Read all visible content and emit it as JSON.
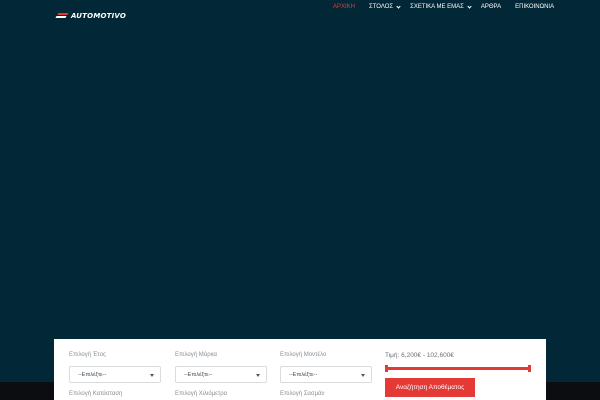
{
  "brand": {
    "logo_text": "AUTOMOTIVO"
  },
  "nav": {
    "items": [
      {
        "label": "ΑΡΧΙΚΗ",
        "active": true,
        "has_dropdown": false
      },
      {
        "label": "ΣΤΟΛΟΣ",
        "active": false,
        "has_dropdown": true
      },
      {
        "label": "ΣΧΕΤΙΚΑ ΜΕ ΕΜΑΣ",
        "active": false,
        "has_dropdown": true
      },
      {
        "label": "ΑΡΘΡΑ",
        "active": false,
        "has_dropdown": false
      },
      {
        "label": "ΕΠΙΚΟΙΝΩΝΙΑ",
        "active": false,
        "has_dropdown": false
      }
    ]
  },
  "search": {
    "fields": [
      {
        "label": "Επιλογή Έτος",
        "value": "--Επιλέξτε--"
      },
      {
        "label": "Επιλογή Μάρκα",
        "value": "--Επιλέξτε--"
      },
      {
        "label": "Επιλογή Μοντέλο",
        "value": "--Επιλέξτε--"
      }
    ],
    "second_row_labels": [
      "Επιλογή Κατάσταση",
      "Επιλογή Χιλιόμετρα",
      "Επιλογή Σασμάν"
    ],
    "price": {
      "label": "Τιμή:",
      "range_text": "6,200€ - 102,600€",
      "min_fraction": 0.0,
      "max_fraction": 1.0
    },
    "submit_label": "Αναζήτηση Αποθέματος"
  },
  "colors": {
    "background": "#022837",
    "accent": "#e53935",
    "panel": "#ffffff",
    "bottom_strip": "#0b0d10"
  },
  "icons": {
    "dropdown_chevron": "chevron-down-icon",
    "select_caret": "caret-down-icon",
    "logo": "automotivo-logo"
  }
}
